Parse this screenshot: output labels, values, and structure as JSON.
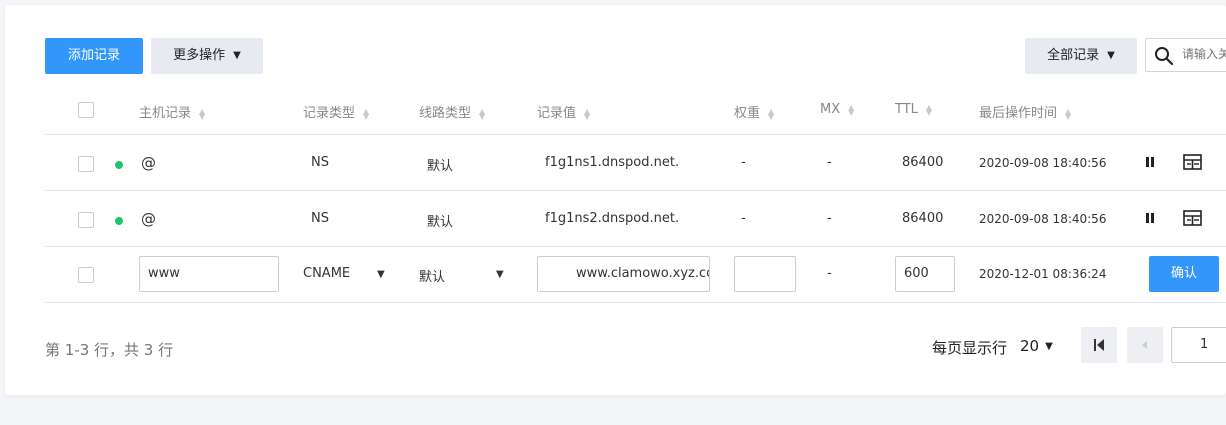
{
  "toolbar": {
    "add_record_label": "添加记录",
    "more_actions_label": "更多操作",
    "all_records_label": "全部记录",
    "search_placeholder": "请输入关"
  },
  "table": {
    "headers": {
      "host": "主机记录",
      "type": "记录类型",
      "line": "线路类型",
      "value": "记录值",
      "weight": "权重",
      "mx": "MX",
      "ttl": "TTL",
      "last_op": "最后操作时间"
    },
    "rows": [
      {
        "host": "@",
        "type": "NS",
        "line": "默认",
        "value": "f1g1ns1.dnspod.net.",
        "weight": "-",
        "mx": "-",
        "ttl": "86400",
        "time": "2020-09-08 18:40:56"
      },
      {
        "host": "@",
        "type": "NS",
        "line": "默认",
        "value": "f1g1ns2.dnspod.net.",
        "weight": "-",
        "mx": "-",
        "ttl": "86400",
        "time": "2020-09-08 18:40:56"
      }
    ],
    "edit_row": {
      "host": "www",
      "type": "CNAME",
      "line": "默认",
      "value": "www.clamowo.xyz.cc",
      "weight": "",
      "mx": "-",
      "ttl": "600",
      "time": "2020-12-01 08:36:24",
      "confirm_label": "确认"
    }
  },
  "footer": {
    "summary": "第 1-3 行，共 3 行",
    "page_size_label": "每页显示行",
    "page_size": "20",
    "current_page": "1"
  },
  "colors": {
    "primary": "#3296fa",
    "status_enabled": "#1fc56f"
  }
}
